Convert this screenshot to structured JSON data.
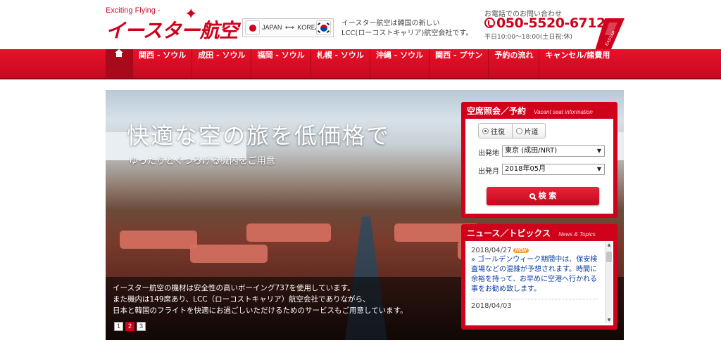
{
  "header": {
    "tagline": "Exciting Flying -",
    "logo": "イースター航空",
    "route_from": "JAPAN",
    "route_arrow": "⟷",
    "route_to": "KOREA",
    "intro_line1": "イースター航空は韓国の新しい",
    "intro_line2": "LCC(ローコストキャリア)航空会社です。",
    "phone_label": "お電話でのお問い合わせ",
    "phone_number": "050-5520-6712",
    "phone_hours": "平日10:00～18:00(土日祝:休)",
    "tail_text": "EASTAR"
  },
  "nav": {
    "home_icon": "home-icon",
    "items": [
      "関西 - ソウル",
      "成田 - ソウル",
      "福岡 - ソウル",
      "札幌 - ソウル",
      "沖縄 - ソウル",
      "関西 - プサン",
      "予約の流れ",
      "キャンセル/諸費用"
    ]
  },
  "hero": {
    "title": "快適な空の旅を低価格で",
    "subtitle": "ゆったりとくつろげる機内をご用意",
    "caption_line1": "イースター航空の機材は安全性の高いボーイング737を使用しています。",
    "caption_line2": "また機内は149席あり、LCC（ローコストキャリア）航空会社でありながら、",
    "caption_line3": "日本と韓国のフライトを快適にお過ごしいただけるためのサービスもご用意しています。",
    "pages": [
      "1",
      "2",
      "3"
    ],
    "active_page": "2"
  },
  "search_panel": {
    "title": "空席照会／予約",
    "subtitle": "Vacant seat information",
    "trip_round": "往復",
    "trip_oneway": "片道",
    "departure_label": "出発地",
    "departure_value": "東京 (成田/NRT)",
    "month_label": "出発月",
    "month_value": "2018年05月",
    "search_button": "検 索"
  },
  "news_panel": {
    "title": "ニュース／トピックス",
    "subtitle": "News & Topics",
    "items": [
      {
        "date": "2018/04/27",
        "badge": "NEW",
        "text": "» ゴールデンウィーク期間中は、保安検査場などの混雑が予想されます。時間に余裕を持って、お早めに空港へ行かれる事をお勧め致します。"
      },
      {
        "date": "2018/04/03"
      }
    ]
  },
  "colors": {
    "brand_red": "#d0021b",
    "link_blue": "#0a3fa8"
  }
}
